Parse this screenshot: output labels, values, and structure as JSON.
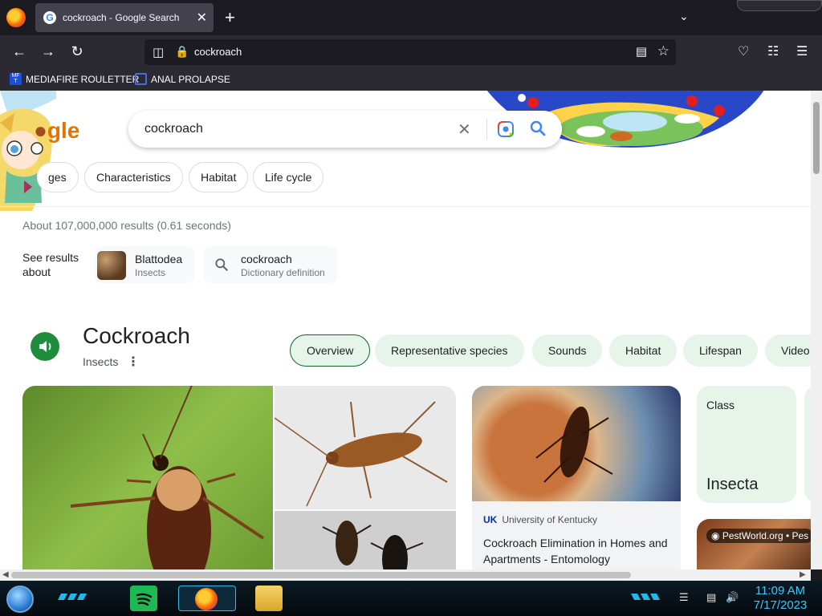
{
  "browser": {
    "tab_title": "cockroach - Google Search",
    "tab_close": "✕",
    "new_tab": "+",
    "url": "cockroach",
    "bookmarks": [
      {
        "label": "MEDIAFIRE ROULETTER",
        "icon": "mediafire-icon"
      },
      {
        "label": "ANAL PROLAPSE",
        "icon": "bookmark-sigma-icon"
      }
    ]
  },
  "search": {
    "query": "cockroach",
    "logo_text": "gle",
    "chips": [
      "ges",
      "Characteristics",
      "Habitat",
      "Life cycle"
    ],
    "stats": "About 107,000,000 results (0.61 seconds)",
    "see_results_about": "See results about",
    "about_items": [
      {
        "title": "Blattodea",
        "subtitle": "Insects"
      },
      {
        "title": "cockroach",
        "subtitle": "Dictionary definition"
      }
    ]
  },
  "knowledge_panel": {
    "title": "Cockroach",
    "subtitle": "Insects",
    "tabs": [
      "Overview",
      "Representative species",
      "Sounds",
      "Habitat",
      "Lifespan",
      "Video"
    ],
    "active_tab": "Overview",
    "result_card": {
      "source": "University of Kentucky",
      "title": "Cockroach Elimination in Homes and Apartments - Entomology"
    },
    "class_card": {
      "label": "Class",
      "value": "Insecta"
    },
    "image_label": "PestWorld.org • Pes"
  },
  "taskbar": {
    "time": "11:09 AM",
    "date": "7/17/2023"
  },
  "colors": {
    "accent_green": "#1e8e3e",
    "chip_green": "#e6f4ea",
    "clock_blue": "#35c8ff"
  }
}
